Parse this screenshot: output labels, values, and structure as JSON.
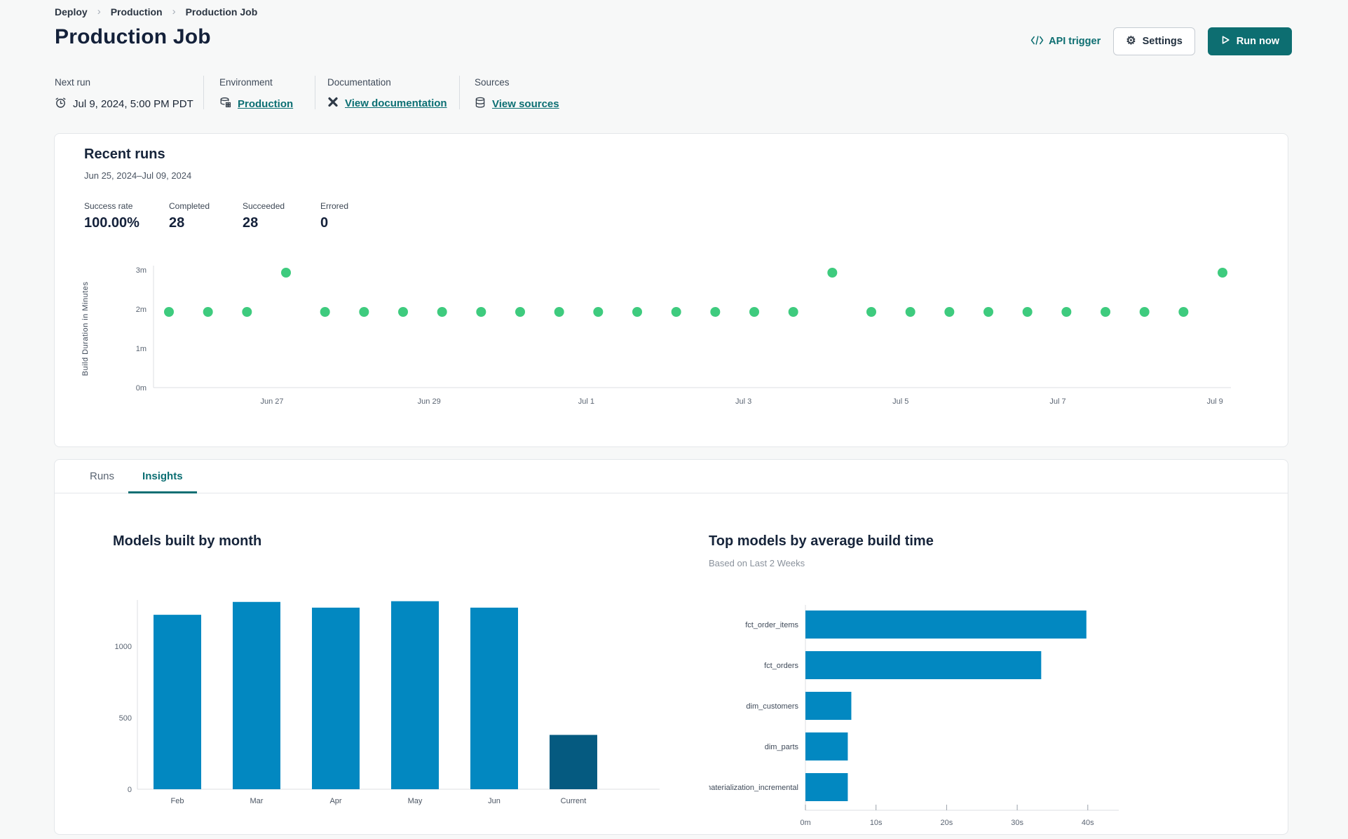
{
  "breadcrumb": {
    "separator": "›",
    "items": [
      {
        "label": "Deploy"
      },
      {
        "label": "Production"
      },
      {
        "label": "Production Job"
      }
    ]
  },
  "header": {
    "title": "Production Job",
    "api_trigger_label": "API trigger",
    "settings_label": "Settings",
    "run_now_label": "Run now"
  },
  "info": {
    "next_run": {
      "label": "Next run",
      "value": "Jul 9, 2024, 5:00 PM PDT"
    },
    "environment": {
      "label": "Environment",
      "value": "Production"
    },
    "documentation": {
      "label": "Documentation",
      "value": "View documentation"
    },
    "sources": {
      "label": "Sources",
      "value": "View sources"
    }
  },
  "recent_runs": {
    "title": "Recent runs",
    "date_range": "Jun 25, 2024–Jul 09, 2024",
    "stats": [
      {
        "label": "Success rate",
        "value": "100.00%"
      },
      {
        "label": "Completed",
        "value": "28"
      },
      {
        "label": "Succeeded",
        "value": "28"
      },
      {
        "label": "Errored",
        "value": "0"
      }
    ]
  },
  "tabs": [
    {
      "label": "Runs",
      "active": false
    },
    {
      "label": "Insights",
      "active": true
    }
  ],
  "colors": {
    "accent_teal": "#0d6e71",
    "success_green": "#3ecb7e",
    "bar_blue": "#0288c1",
    "bar_dark_blue": "#055a80",
    "axis_gray": "#dcdfe3",
    "axis_text": "#5b6573"
  },
  "chart_data": [
    {
      "type": "scatter",
      "title": "Recent runs",
      "ylabel": "Build Duration in Minutes",
      "y_ticks": [
        "0m",
        "1m",
        "2m",
        "3m"
      ],
      "ylim": [
        0,
        3.5
      ],
      "x_tick_labels": [
        "Jun 27",
        "Jun 29",
        "Jul 1",
        "Jul 3",
        "Jul 5",
        "Jul 7",
        "Jul 9"
      ],
      "values_minutes": [
        2,
        2,
        2,
        3,
        2,
        2,
        2,
        2,
        2,
        2,
        2,
        2,
        2,
        2,
        2,
        2,
        2,
        3,
        2,
        2,
        2,
        2,
        2,
        2,
        2,
        2,
        2,
        3
      ],
      "point_color": "#3ecb7e",
      "grid": false,
      "legend": "none"
    },
    {
      "type": "bar",
      "title": "Models built by month",
      "categories": [
        "Feb",
        "Mar",
        "Apr",
        "May",
        "Jun",
        "Current"
      ],
      "values": [
        1220,
        1310,
        1270,
        1315,
        1270,
        380
      ],
      "bar_colors": [
        "#0288c1",
        "#0288c1",
        "#0288c1",
        "#0288c1",
        "#0288c1",
        "#055a80"
      ],
      "xlabel": "",
      "ylabel": "",
      "y_ticks": [
        0,
        500,
        1000
      ],
      "ylim": [
        0,
        1400
      ],
      "grid": false,
      "legend": "none"
    },
    {
      "type": "bar",
      "orientation": "horizontal",
      "title": "Top models by average build time",
      "subtitle": "Based on Last 2 Weeks",
      "categories": [
        "fct_order_items",
        "fct_orders",
        "dim_customers",
        "dim_parts",
        "materialization_incremental"
      ],
      "values_seconds": [
        39.8,
        33.4,
        6.5,
        6.0,
        6.0
      ],
      "bar_color": "#0288c1",
      "x_ticks": [
        "0m",
        "10s",
        "20s",
        "30s",
        "40s"
      ],
      "x_tick_values": [
        0,
        10,
        20,
        30,
        40
      ],
      "xlim": [
        0,
        44
      ],
      "grid": false,
      "legend": "none"
    }
  ]
}
